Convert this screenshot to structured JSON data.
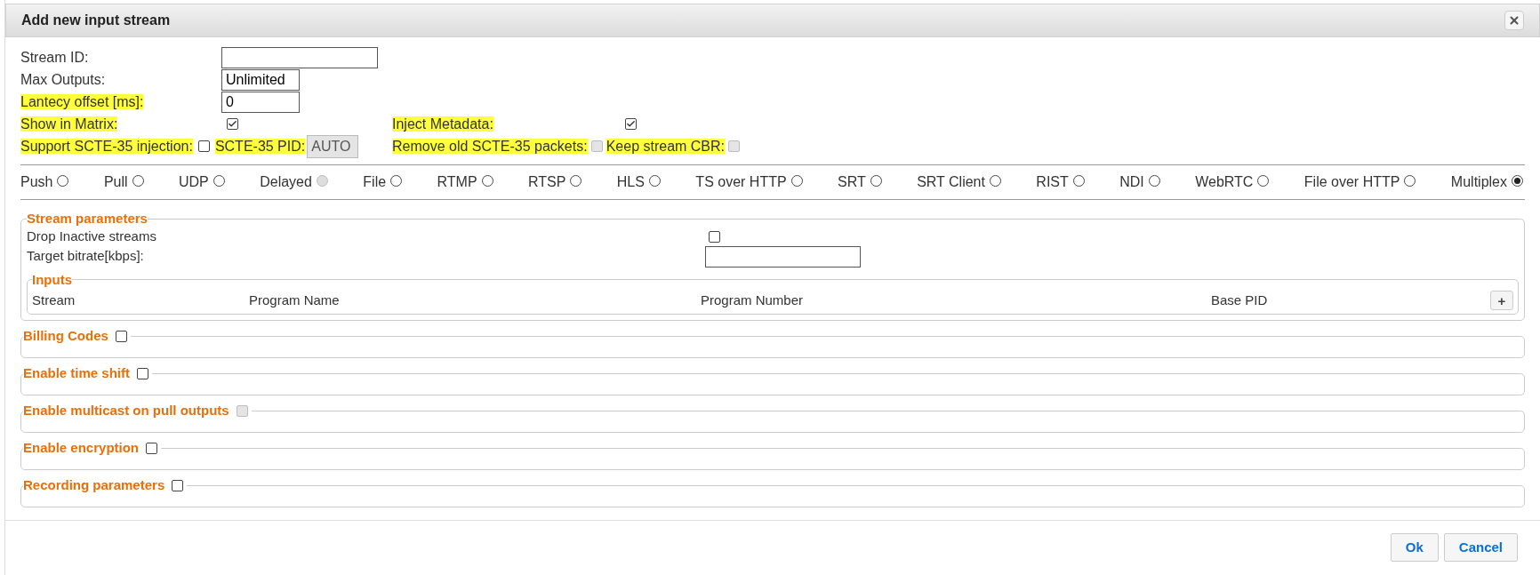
{
  "dialog": {
    "title": "Add new input stream"
  },
  "settings": [
    {
      "kind": "pair",
      "left": [
        {
          "kind": "label",
          "text": "Stream ID:",
          "highlighted": false
        },
        {
          "kind": "wide_text"
        }
      ]
    },
    {
      "kind": "pair",
      "left": [
        {
          "kind": "label",
          "text": "Max Outputs:",
          "highlighted": false
        },
        {
          "kind": "text",
          "value": "Unlimited"
        }
      ]
    },
    {
      "kind": "pair",
      "left": [
        {
          "kind": "label",
          "text": "Lantecy offset [ms]:",
          "highlighted": true
        },
        {
          "kind": "text",
          "value": "0"
        }
      ]
    },
    {
      "kind": "pair",
      "left": [
        {
          "kind": "label",
          "text": "Show in Matrix:",
          "highlighted": true
        },
        {
          "kind": "checkbox",
          "checked": true,
          "disabled": false
        }
      ],
      "right": [
        {
          "kind": "label",
          "text": "Inject Metadata:",
          "highlighted": true
        },
        {
          "kind": "checkbox",
          "checked": true,
          "disabled": false
        }
      ]
    },
    {
      "kind": "inline",
      "left": [
        {
          "kind": "label",
          "text": "Support SCTE-35 injection:",
          "highlighted": true
        },
        {
          "kind": "checkbox",
          "checked": false,
          "disabled": false
        },
        {
          "kind": "label",
          "text": "SCTE-35 PID:",
          "highlighted": true
        },
        {
          "kind": "disabled_text",
          "value": "AUTO"
        }
      ],
      "right": [
        {
          "kind": "label",
          "text": "Remove old SCTE-35 packets:",
          "highlighted": true
        },
        {
          "kind": "checkbox",
          "checked": false,
          "disabled": true
        },
        {
          "kind": "label",
          "text": "Keep stream CBR:",
          "highlighted": true
        },
        {
          "kind": "checkbox",
          "checked": false,
          "disabled": true
        }
      ]
    }
  ],
  "stream_types": [
    {
      "label": "Push",
      "selected": false,
      "disabled": false
    },
    {
      "label": "Pull",
      "selected": false,
      "disabled": false
    },
    {
      "label": "UDP",
      "selected": false,
      "disabled": false
    },
    {
      "label": "Delayed",
      "selected": false,
      "disabled": true
    },
    {
      "label": "File",
      "selected": false,
      "disabled": false
    },
    {
      "label": "RTMP",
      "selected": false,
      "disabled": false
    },
    {
      "label": "RTSP",
      "selected": false,
      "disabled": false
    },
    {
      "label": "HLS",
      "selected": false,
      "disabled": false
    },
    {
      "label": "TS over HTTP",
      "selected": false,
      "disabled": false
    },
    {
      "label": "SRT",
      "selected": false,
      "disabled": false
    },
    {
      "label": "SRT Client",
      "selected": false,
      "disabled": false
    },
    {
      "label": "RIST",
      "selected": false,
      "disabled": false
    },
    {
      "label": "NDI",
      "selected": false,
      "disabled": false
    },
    {
      "label": "WebRTC",
      "selected": false,
      "disabled": false
    },
    {
      "label": "File over HTTP",
      "selected": false,
      "disabled": false
    },
    {
      "label": "Multiplex",
      "selected": true,
      "disabled": false
    }
  ],
  "stream_parameters": {
    "title": "Stream parameters",
    "drop_inactive": {
      "label": "Drop Inactive streams",
      "checked": false
    },
    "target_bitrate": {
      "label": "Target bitrate[kbps]:"
    },
    "inputs": {
      "title": "Inputs",
      "columns": [
        "Stream",
        "Program Name",
        "Program Number",
        "Base PID"
      ],
      "add_button": "+"
    }
  },
  "sections": [
    {
      "title": "Billing Codes",
      "checked": false,
      "disabled": false
    },
    {
      "title": "Enable time shift",
      "checked": false,
      "disabled": false
    },
    {
      "title": "Enable multicast on pull outputs",
      "checked": false,
      "disabled": true
    },
    {
      "title": "Enable encryption",
      "checked": false,
      "disabled": false
    },
    {
      "title": "Recording parameters",
      "checked": false,
      "disabled": false
    }
  ],
  "buttons": [
    "Ok",
    "Cancel"
  ]
}
